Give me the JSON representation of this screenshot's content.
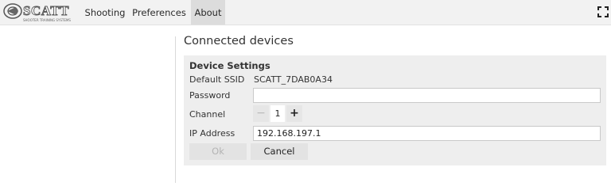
{
  "app": {
    "logo_text": "SCATT",
    "logo_subtitle": "SHOOTER TRAINING SYSTEMS"
  },
  "nav": {
    "items": [
      {
        "label": "Shooting"
      },
      {
        "label": "Preferences"
      },
      {
        "label": "About"
      }
    ],
    "active": "About",
    "fullscreen_icon": "fullscreen-icon"
  },
  "page": {
    "title": "Connected devices"
  },
  "device_settings": {
    "title": "Device Settings",
    "ssid_label": "Default SSID",
    "ssid_value": "SCATT_7DAB0A34",
    "password_label": "Password",
    "password_value": "",
    "channel_label": "Channel",
    "channel_value": "1",
    "channel_decrement": "−",
    "channel_increment": "+",
    "ip_label": "IP Address",
    "ip_value": "192.168.197.1",
    "ok_label": "Ok",
    "cancel_label": "Cancel"
  },
  "colors": {
    "topbar_bg": "#f2f2f2",
    "active_tab_bg": "#dcdcdc",
    "panel_bg": "#eeeeee",
    "disabled_text": "#b4b4b4"
  }
}
